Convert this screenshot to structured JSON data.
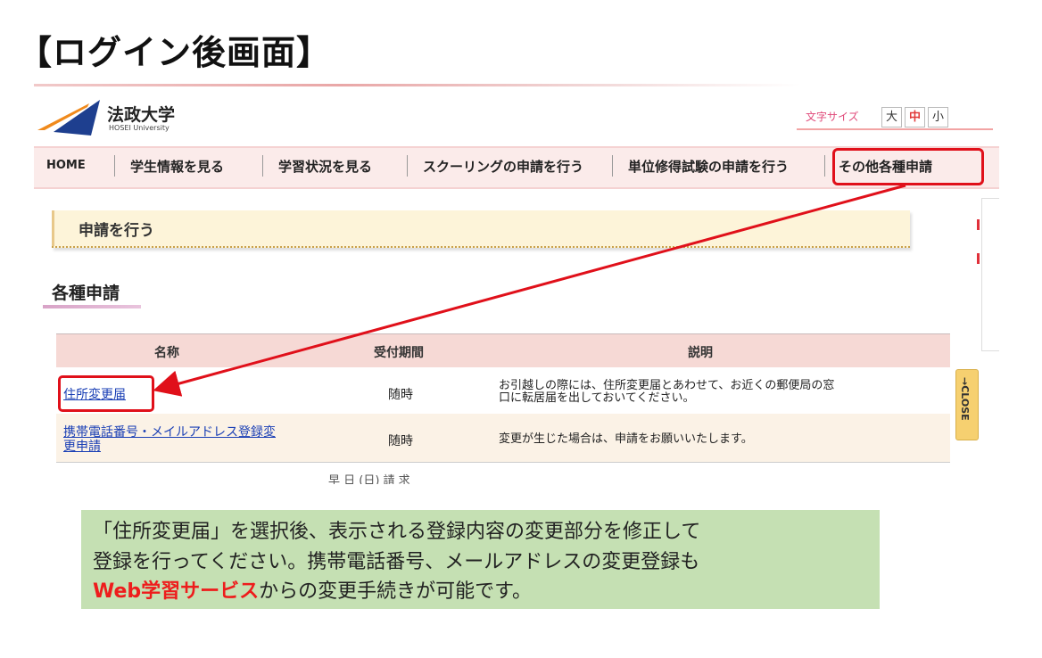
{
  "page": {
    "heading": "【ログイン後画面】"
  },
  "header": {
    "logo_jp": "法政大学",
    "logo_en": "HOSEI University",
    "font_size_label": "文字サイズ",
    "font_sizes": [
      "大",
      "中",
      "小"
    ]
  },
  "nav": {
    "items": [
      "HOME",
      "学生情報を見る",
      "学習状況を見る",
      "スクーリングの申請を行う",
      "単位修得試験の申請を行う",
      "その他各種申請"
    ],
    "highlighted": "その他各種申請"
  },
  "main": {
    "box_heading": "申請を行う",
    "section_title": "各種申請",
    "close_tab": "→CLOSE",
    "table": {
      "headers": [
        "名称",
        "受付期間",
        "説明"
      ],
      "rows": [
        {
          "name": "住所変更届",
          "period": "随時",
          "desc_line1": "お引越しの際には、住所変更届とあわせて、お近くの郵便局の窓",
          "desc_line2": "口に転居届を出しておいてください。"
        },
        {
          "name_line1": "携帯電話番号・メイルアドレス登録変",
          "name_line2": "更申請",
          "period": "随時",
          "desc": "変更が生じた場合は、申請をお願いいたします。"
        }
      ],
      "cut_off_text": "早 日 (日) 請 求"
    }
  },
  "note": {
    "line1": "「住所変更届」を選択後、表示される登録内容の変更部分を修正して",
    "line2": "登録を行ってください。携帯電話番号、メールアドレスの変更登録も",
    "line3_emph": "Web学習サービス",
    "line3_rest": "からの変更手続きが可能です。"
  },
  "colors": {
    "highlight_red": "#e0101a",
    "note_bg": "#c5e0b3",
    "nav_bg": "#fbebea",
    "table_head_bg": "#f6d9d5",
    "emph_red": "#ee1c1c"
  }
}
